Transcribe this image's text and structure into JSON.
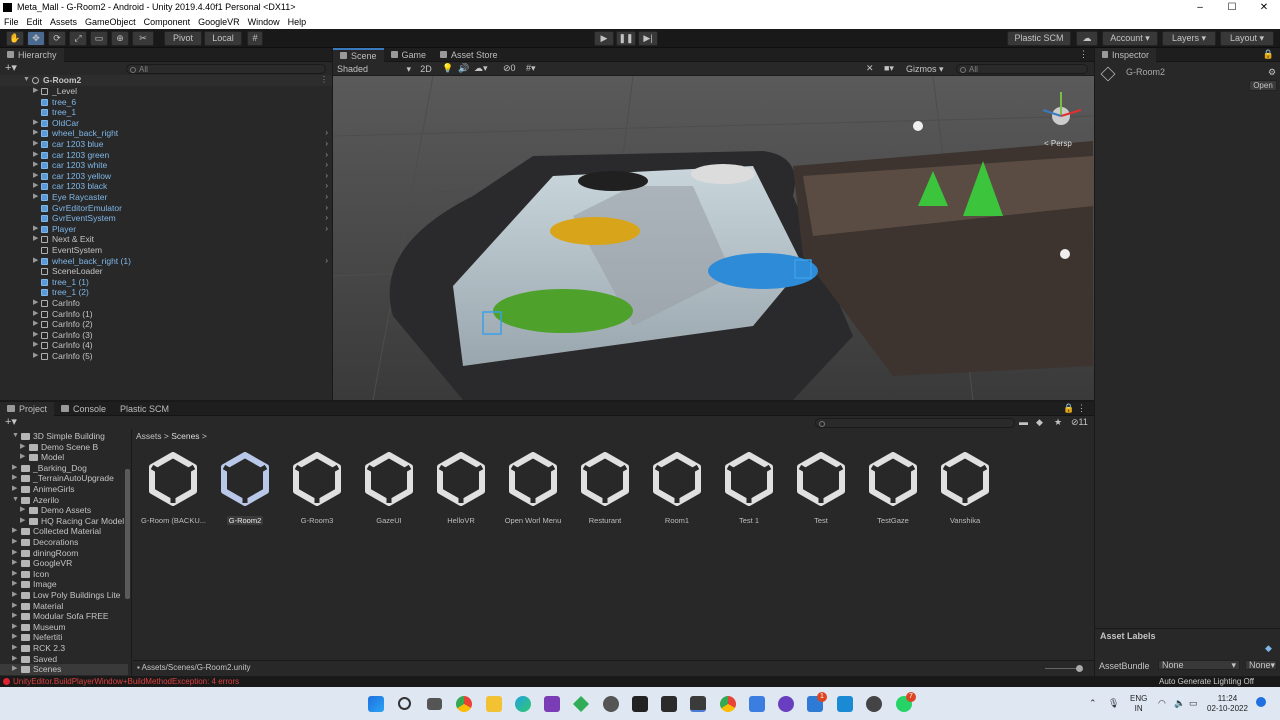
{
  "window": {
    "title": "Meta_Mall - G-Room2 - Android - Unity 2019.4.40f1 Personal <DX11>",
    "controls": [
      "–",
      "☐",
      "✕"
    ]
  },
  "menu": [
    "File",
    "Edit",
    "Assets",
    "GameObject",
    "Component",
    "GoogleVR",
    "Window",
    "Help"
  ],
  "toolbar": {
    "pivot": "Pivot",
    "local": "Local",
    "plastic_scm": "Plastic SCM",
    "account": "Account",
    "layers": "Layers",
    "layout": "Layout"
  },
  "hierarchy": {
    "tab": "Hierarchy",
    "search_placeholder": "All",
    "root": "G-Room2",
    "items": [
      {
        "label": "_Level",
        "prefab": false,
        "arrow": true,
        "right": false
      },
      {
        "label": "tree_6",
        "prefab": true,
        "arrow": false,
        "right": false
      },
      {
        "label": "tree_1",
        "prefab": true,
        "arrow": false,
        "right": false
      },
      {
        "label": "OldCar",
        "prefab": true,
        "arrow": true,
        "right": false
      },
      {
        "label": "wheel_back_right",
        "prefab": true,
        "arrow": true,
        "right": true
      },
      {
        "label": "car 1203 blue",
        "prefab": true,
        "arrow": true,
        "right": true
      },
      {
        "label": "car 1203 green",
        "prefab": true,
        "arrow": true,
        "right": true
      },
      {
        "label": "car 1203 white",
        "prefab": true,
        "arrow": true,
        "right": true
      },
      {
        "label": "car 1203 yellow",
        "prefab": true,
        "arrow": true,
        "right": true
      },
      {
        "label": "car 1203 black",
        "prefab": true,
        "arrow": true,
        "right": true
      },
      {
        "label": "Eye Raycaster",
        "prefab": true,
        "arrow": true,
        "right": true
      },
      {
        "label": "GvrEditorEmulator",
        "prefab": true,
        "arrow": false,
        "right": true
      },
      {
        "label": "GvrEventSystem",
        "prefab": true,
        "arrow": false,
        "right": true
      },
      {
        "label": "Player",
        "prefab": true,
        "arrow": true,
        "right": true
      },
      {
        "label": "Next & Exit",
        "prefab": false,
        "arrow": true,
        "right": false
      },
      {
        "label": "EventSystem",
        "prefab": false,
        "arrow": false,
        "right": false
      },
      {
        "label": "wheel_back_right (1)",
        "prefab": true,
        "arrow": true,
        "right": true
      },
      {
        "label": "SceneLoader",
        "prefab": false,
        "arrow": false,
        "right": false
      },
      {
        "label": "tree_1 (1)",
        "prefab": true,
        "arrow": false,
        "right": false
      },
      {
        "label": "tree_1 (2)",
        "prefab": true,
        "arrow": false,
        "right": false
      },
      {
        "label": "CarInfo",
        "prefab": false,
        "arrow": true,
        "right": false
      },
      {
        "label": "CarInfo (1)",
        "prefab": false,
        "arrow": true,
        "right": false
      },
      {
        "label": "CarInfo (2)",
        "prefab": false,
        "arrow": true,
        "right": false
      },
      {
        "label": "CarInfo (3)",
        "prefab": false,
        "arrow": true,
        "right": false
      },
      {
        "label": "CarInfo (4)",
        "prefab": false,
        "arrow": true,
        "right": false
      },
      {
        "label": "CarInfo (5)",
        "prefab": false,
        "arrow": true,
        "right": false
      }
    ]
  },
  "scene_view": {
    "tabs": [
      "Scene",
      "Game",
      "Asset Store"
    ],
    "shading": "Shaded",
    "mode_2d": "2D",
    "fx_count": "0",
    "gizmos": "Gizmos",
    "search_placeholder": "All",
    "persp": "< Persp"
  },
  "inspector": {
    "tab": "Inspector",
    "object": "G-Room2",
    "open_button": "Open",
    "asset_labels": "Asset Labels",
    "asset_bundle_label": "AssetBundle",
    "asset_bundle_value": "None",
    "asset_variant_value": "None"
  },
  "project": {
    "tabs": [
      "Project",
      "Console",
      "Plastic SCM"
    ],
    "breadcrumb": [
      "Assets",
      "Scenes"
    ],
    "hidden_count": "11",
    "folders": [
      {
        "label": "3D Simple Building",
        "indent": 1,
        "open": true
      },
      {
        "label": "Demo Scene B",
        "indent": 2,
        "open": false
      },
      {
        "label": "Model",
        "indent": 2,
        "open": false
      },
      {
        "label": "_Barking_Dog",
        "indent": 1,
        "open": false
      },
      {
        "label": "_TerrainAutoUpgrade",
        "indent": 1,
        "open": false
      },
      {
        "label": "AnimeGirls",
        "indent": 1,
        "open": false
      },
      {
        "label": "Azerilo",
        "indent": 1,
        "open": true
      },
      {
        "label": "Demo Assets",
        "indent": 2,
        "open": false
      },
      {
        "label": "HQ Racing Car Model",
        "indent": 2,
        "open": false
      },
      {
        "label": "Collected Material",
        "indent": 1,
        "open": false
      },
      {
        "label": "Decorations",
        "indent": 1,
        "open": false
      },
      {
        "label": "diningRoom",
        "indent": 1,
        "open": false
      },
      {
        "label": "GoogleVR",
        "indent": 1,
        "open": false
      },
      {
        "label": "Icon",
        "indent": 1,
        "open": false
      },
      {
        "label": "Image",
        "indent": 1,
        "open": false
      },
      {
        "label": "Low Poly Buildings Lite",
        "indent": 1,
        "open": false
      },
      {
        "label": "Material",
        "indent": 1,
        "open": false
      },
      {
        "label": "Modular Sofa FREE",
        "indent": 1,
        "open": false
      },
      {
        "label": "Museum",
        "indent": 1,
        "open": false
      },
      {
        "label": "Nefertiti",
        "indent": 1,
        "open": false
      },
      {
        "label": "RCK 2.3",
        "indent": 1,
        "open": false
      },
      {
        "label": "Saved",
        "indent": 1,
        "open": false
      },
      {
        "label": "Scenes",
        "indent": 1,
        "open": false,
        "selected": true
      }
    ],
    "scenes": [
      "G-Room (BACKU...",
      "G-Room2",
      "G-Room3",
      "GazeUI",
      "HelloVR",
      "Open Worl Menu",
      "Resturant",
      "Room1",
      "Test 1",
      "Test",
      "TestGaze",
      "Vanshika"
    ],
    "selected_scene": "G-Room2",
    "path": "Assets/Scenes/G-Room2.unity"
  },
  "status": {
    "error": "UnityEditor.BuildPlayerWindow+BuildMethodException: 4 errors",
    "lighting": "Auto Generate Lighting Off"
  },
  "taskbar": {
    "lang_line1": "ENG",
    "lang_line2": "IN",
    "time": "11:24",
    "date": "02-10-2022",
    "badge_mail": "1",
    "badge_whatsapp": "7"
  }
}
